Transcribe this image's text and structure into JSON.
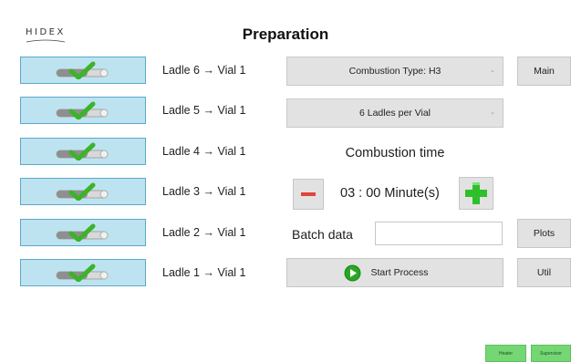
{
  "logo": {
    "text": "HIDEX"
  },
  "title": "Preparation",
  "ladles": [
    {
      "label": "Ladle 6 → Vial 1"
    },
    {
      "label": "Ladle 5 → Vial 1"
    },
    {
      "label": "Ladle 4 → Vial 1"
    },
    {
      "label": "Ladle 3 → Vial 1"
    },
    {
      "label": "Ladle 2 → Vial 1"
    },
    {
      "label": "Ladle 1 → Vial 1"
    }
  ],
  "combustion_type_select": {
    "value": "Combustion Type: H3"
  },
  "ladles_per_vial_select": {
    "value": "6 Ladles per Vial"
  },
  "combustion_time": {
    "label": "Combustion time",
    "value": "03 : 00 Minute(s)"
  },
  "batch": {
    "label": "Batch data",
    "value": ""
  },
  "start_button": {
    "label": "Start Process"
  },
  "nav": {
    "main": "Main",
    "plots": "Plots",
    "util": "Util"
  },
  "footer": {
    "heater": "Heater",
    "supervisor": "Supervisor"
  },
  "colors": {
    "ladle_button_bg": "#bde3f0",
    "ladle_button_border": "#5aa9c9",
    "check_green": "#3cb32a",
    "minus_red": "#e0453a",
    "plus_green": "#2fbf2a",
    "footer_green": "#74d774"
  },
  "icons": {
    "ladle_toggle": "check-toggle-icon",
    "decrease": "minus-icon",
    "increase": "plus-icon",
    "start": "play-icon"
  }
}
